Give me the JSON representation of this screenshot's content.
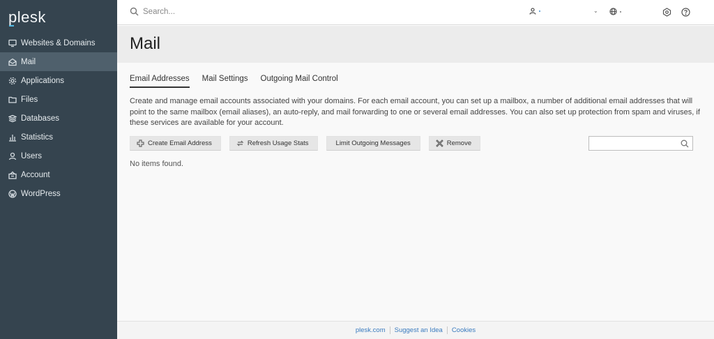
{
  "brand": {
    "logo_text": "plesk"
  },
  "sidebar": {
    "items": [
      {
        "label": "Websites & Domains",
        "icon": "monitor-icon"
      },
      {
        "label": "Mail",
        "icon": "mail-icon",
        "active": true
      },
      {
        "label": "Applications",
        "icon": "gear-icon"
      },
      {
        "label": "Files",
        "icon": "folder-icon"
      },
      {
        "label": "Databases",
        "icon": "database-icon"
      },
      {
        "label": "Statistics",
        "icon": "chart-icon"
      },
      {
        "label": "Users",
        "icon": "user-icon"
      },
      {
        "label": "Account",
        "icon": "account-icon"
      },
      {
        "label": "WordPress",
        "icon": "wordpress-icon"
      }
    ],
    "collapse_glyph": "‹"
  },
  "topbar": {
    "search_placeholder": "Search...",
    "user_glyph": "·",
    "chevron": "⌄",
    "globe_glyph": ":"
  },
  "page": {
    "title": "Mail"
  },
  "tabs": [
    {
      "label": "Email Addresses",
      "active": true
    },
    {
      "label": "Mail Settings"
    },
    {
      "label": "Outgoing Mail Control"
    }
  ],
  "description": "Create and manage email accounts associated with your domains. For each email account, you can set up a mailbox, a number of additional email addresses that will point to the same mailbox (email aliases), an auto-reply, and mail forwarding to one or several email addresses. You can also set up protection from spam and viruses, if these services are available for your account.",
  "toolbar": {
    "create_label": "Create Email Address",
    "refresh_label": "Refresh Usage Stats",
    "limit_label": "Limit Outgoing Messages",
    "remove_label": "Remove"
  },
  "list": {
    "search_placeholder": "",
    "empty_text": "No items found."
  },
  "footer": {
    "links": [
      "plesk.com",
      "Suggest an Idea",
      "Cookies"
    ]
  },
  "colors": {
    "sidebar_bg": "#35444f",
    "sidebar_active": "#4f606c",
    "link": "#3a7bbf"
  }
}
